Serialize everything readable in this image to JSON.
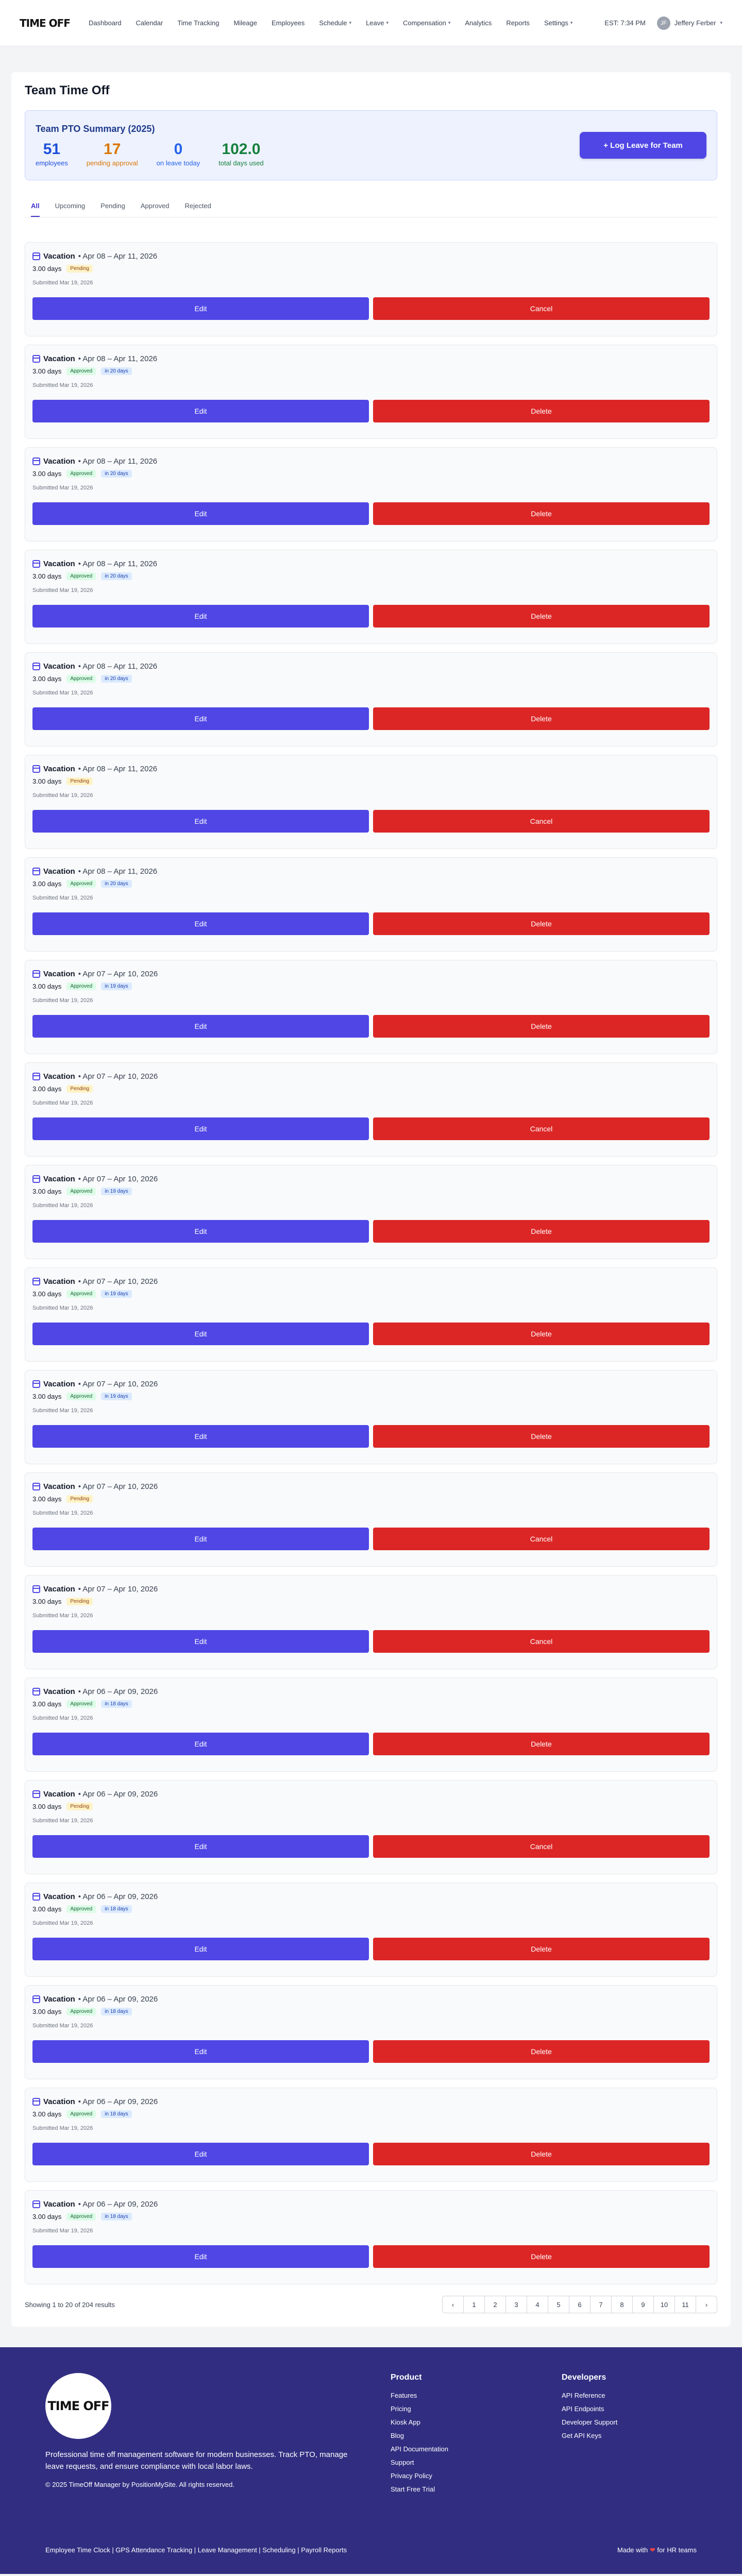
{
  "nav": {
    "logo": "TIME OFF",
    "links": [
      {
        "label": "Dashboard",
        "dropdown": false
      },
      {
        "label": "Calendar",
        "dropdown": false
      },
      {
        "label": "Time Tracking",
        "dropdown": false
      },
      {
        "label": "Mileage",
        "dropdown": false
      },
      {
        "label": "Employees",
        "dropdown": false
      },
      {
        "label": "Schedule",
        "dropdown": true
      },
      {
        "label": "Leave",
        "dropdown": true
      },
      {
        "label": "Compensation",
        "dropdown": true
      },
      {
        "label": "Analytics",
        "dropdown": false
      },
      {
        "label": "Reports",
        "dropdown": false
      },
      {
        "label": "Settings",
        "dropdown": true
      }
    ],
    "clock": "EST: 7:34 PM",
    "user_initials": "JF",
    "user_name": "Jeffery Ferber"
  },
  "page": {
    "title": "Team Time Off",
    "summary": {
      "title": "Team PTO Summary (2025)",
      "stats": [
        {
          "value": "51",
          "label": "employees",
          "color": "#1d4ed8"
        },
        {
          "value": "17",
          "label": "pending approval",
          "color": "#d97706"
        },
        {
          "value": "0",
          "label": "on leave today",
          "color": "#2563eb"
        },
        {
          "value": "102.0",
          "label": "total days used",
          "color": "#15803d"
        }
      ],
      "log_button": "+ Log Leave for Team"
    },
    "tabs": [
      "All",
      "Upcoming",
      "Pending",
      "Approved",
      "Rejected"
    ],
    "active_tab": "All",
    "requests": [
      {
        "type": "Vacation",
        "range": "• Apr 08 – Apr 11, 2026",
        "days": "3.00 days",
        "status": "Pending",
        "in_days": "",
        "submitted": "Submitted Mar 19, 2026",
        "edit": "Edit",
        "action": "Cancel"
      },
      {
        "type": "Vacation",
        "range": "• Apr 08 – Apr 11, 2026",
        "days": "3.00 days",
        "status": "Approved",
        "in_days": "in 20 days",
        "submitted": "Submitted Mar 19, 2026",
        "edit": "Edit",
        "action": "Delete"
      },
      {
        "type": "Vacation",
        "range": "• Apr 08 – Apr 11, 2026",
        "days": "3.00 days",
        "status": "Approved",
        "in_days": "in 20 days",
        "submitted": "Submitted Mar 19, 2026",
        "edit": "Edit",
        "action": "Delete"
      },
      {
        "type": "Vacation",
        "range": "• Apr 08 – Apr 11, 2026",
        "days": "3.00 days",
        "status": "Approved",
        "in_days": "in 20 days",
        "submitted": "Submitted Mar 19, 2026",
        "edit": "Edit",
        "action": "Delete"
      },
      {
        "type": "Vacation",
        "range": "• Apr 08 – Apr 11, 2026",
        "days": "3.00 days",
        "status": "Approved",
        "in_days": "in 20 days",
        "submitted": "Submitted Mar 19, 2026",
        "edit": "Edit",
        "action": "Delete"
      },
      {
        "type": "Vacation",
        "range": "• Apr 08 – Apr 11, 2026",
        "days": "3.00 days",
        "status": "Pending",
        "in_days": "",
        "submitted": "Submitted Mar 19, 2026",
        "edit": "Edit",
        "action": "Cancel"
      },
      {
        "type": "Vacation",
        "range": "• Apr 08 – Apr 11, 2026",
        "days": "3.00 days",
        "status": "Approved",
        "in_days": "in 20 days",
        "submitted": "Submitted Mar 19, 2026",
        "edit": "Edit",
        "action": "Delete"
      },
      {
        "type": "Vacation",
        "range": "• Apr 07 – Apr 10, 2026",
        "days": "3.00 days",
        "status": "Approved",
        "in_days": "in 19 days",
        "submitted": "Submitted Mar 19, 2026",
        "edit": "Edit",
        "action": "Delete"
      },
      {
        "type": "Vacation",
        "range": "• Apr 07 – Apr 10, 2026",
        "days": "3.00 days",
        "status": "Pending",
        "in_days": "",
        "submitted": "Submitted Mar 19, 2026",
        "edit": "Edit",
        "action": "Cancel"
      },
      {
        "type": "Vacation",
        "range": "• Apr 07 – Apr 10, 2026",
        "days": "3.00 days",
        "status": "Approved",
        "in_days": "in 19 days",
        "submitted": "Submitted Mar 19, 2026",
        "edit": "Edit",
        "action": "Delete"
      },
      {
        "type": "Vacation",
        "range": "• Apr 07 – Apr 10, 2026",
        "days": "3.00 days",
        "status": "Approved",
        "in_days": "in 19 days",
        "submitted": "Submitted Mar 19, 2026",
        "edit": "Edit",
        "action": "Delete"
      },
      {
        "type": "Vacation",
        "range": "• Apr 07 – Apr 10, 2026",
        "days": "3.00 days",
        "status": "Approved",
        "in_days": "in 19 days",
        "submitted": "Submitted Mar 19, 2026",
        "edit": "Edit",
        "action": "Delete"
      },
      {
        "type": "Vacation",
        "range": "• Apr 07 – Apr 10, 2026",
        "days": "3.00 days",
        "status": "Pending",
        "in_days": "",
        "submitted": "Submitted Mar 19, 2026",
        "edit": "Edit",
        "action": "Cancel"
      },
      {
        "type": "Vacation",
        "range": "• Apr 07 – Apr 10, 2026",
        "days": "3.00 days",
        "status": "Pending",
        "in_days": "",
        "submitted": "Submitted Mar 19, 2026",
        "edit": "Edit",
        "action": "Cancel"
      },
      {
        "type": "Vacation",
        "range": "• Apr 06 – Apr 09, 2026",
        "days": "3.00 days",
        "status": "Approved",
        "in_days": "in 18 days",
        "submitted": "Submitted Mar 19, 2026",
        "edit": "Edit",
        "action": "Delete"
      },
      {
        "type": "Vacation",
        "range": "• Apr 06 – Apr 09, 2026",
        "days": "3.00 days",
        "status": "Pending",
        "in_days": "",
        "submitted": "Submitted Mar 19, 2026",
        "edit": "Edit",
        "action": "Cancel"
      },
      {
        "type": "Vacation",
        "range": "• Apr 06 – Apr 09, 2026",
        "days": "3.00 days",
        "status": "Approved",
        "in_days": "in 18 days",
        "submitted": "Submitted Mar 19, 2026",
        "edit": "Edit",
        "action": "Delete"
      },
      {
        "type": "Vacation",
        "range": "• Apr 06 – Apr 09, 2026",
        "days": "3.00 days",
        "status": "Approved",
        "in_days": "in 18 days",
        "submitted": "Submitted Mar 19, 2026",
        "edit": "Edit",
        "action": "Delete"
      },
      {
        "type": "Vacation",
        "range": "• Apr 06 – Apr 09, 2026",
        "days": "3.00 days",
        "status": "Approved",
        "in_days": "in 18 days",
        "submitted": "Submitted Mar 19, 2026",
        "edit": "Edit",
        "action": "Delete"
      },
      {
        "type": "Vacation",
        "range": "• Apr 06 – Apr 09, 2026",
        "days": "3.00 days",
        "status": "Approved",
        "in_days": "in 18 days",
        "submitted": "Submitted Mar 19, 2026",
        "edit": "Edit",
        "action": "Delete"
      }
    ],
    "pagination": {
      "results_text": "Showing 1 to 20 of 204 results",
      "prev": "‹",
      "pages": [
        "1",
        "2",
        "3",
        "4",
        "5",
        "6",
        "7",
        "8",
        "9",
        "10",
        "11"
      ],
      "next": "›"
    }
  },
  "footer": {
    "logo": "TIME OFF",
    "description": "Professional time off management software for modern businesses. Track PTO, manage leave requests, and ensure compliance with local labor laws.",
    "copyright": "© 2025 TimeOff Manager by PositionMySite. All rights reserved.",
    "product": {
      "heading": "Product",
      "links": [
        "Features",
        "Pricing",
        "Kiosk App",
        "Blog",
        "API Documentation",
        "Support",
        "Privacy Policy",
        "Start Free Trial"
      ]
    },
    "developers": {
      "heading": "Developers",
      "links": [
        "API Reference",
        "API Endpoints",
        "Developer Support",
        "Get API Keys"
      ]
    },
    "bottom_links": "Employee Time Clock | GPS Attendance Tracking | Leave Management | Scheduling | Payroll Reports",
    "made_with_prefix": "Made with",
    "made_with_suffix": "for HR teams",
    "heart": "❤"
  }
}
